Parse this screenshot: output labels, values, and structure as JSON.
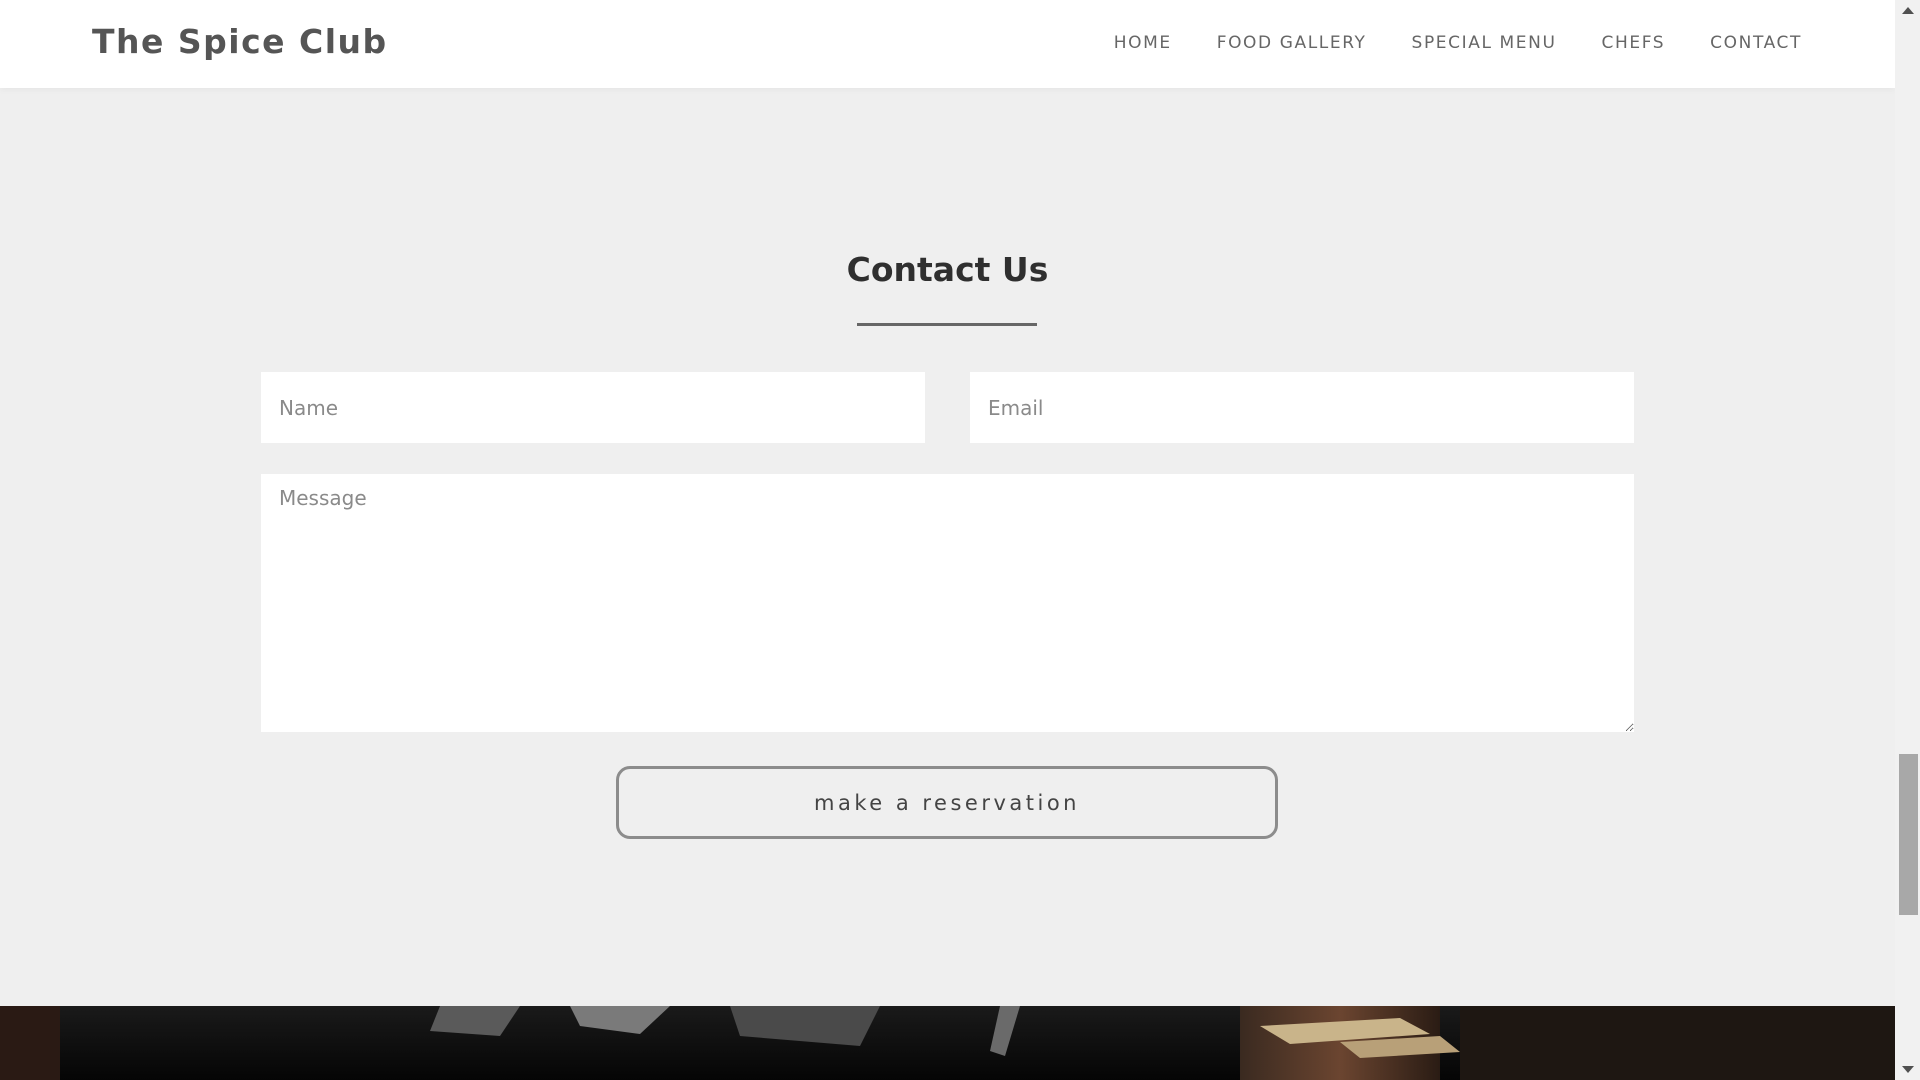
{
  "navbar": {
    "brand": "The Spice Club",
    "links": [
      "HOME",
      "FOOD GALLERY",
      "SPECIAL MENU",
      "CHEFS",
      "CONTACT"
    ]
  },
  "contact": {
    "title": "Contact Us",
    "name_placeholder": "Name",
    "email_placeholder": "Email",
    "message_placeholder": "Message",
    "button_label": "make a reservation"
  },
  "colors": {
    "background": "#efefef",
    "navbar": "#ffffff",
    "button_border": "#8c8c8c"
  }
}
